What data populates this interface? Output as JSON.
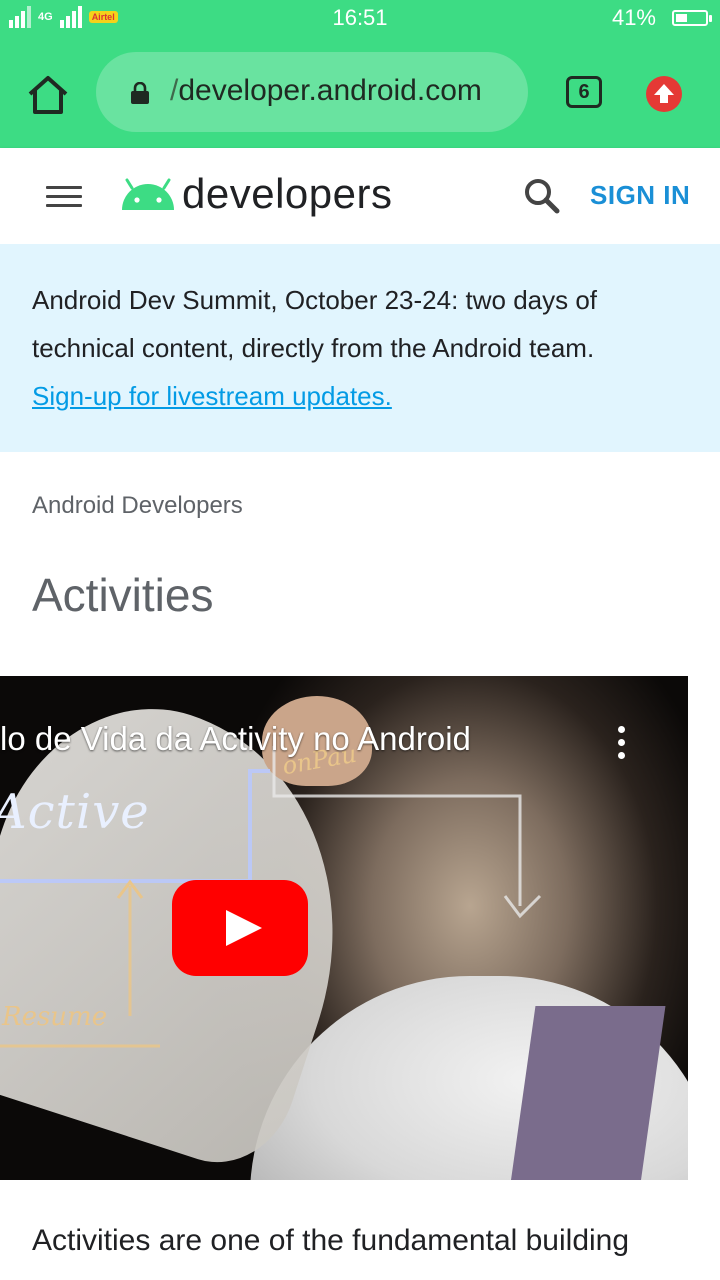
{
  "status_bar": {
    "network": "4G",
    "carrier_tag": "Airtel",
    "time": "16:51",
    "battery_percent": "41%",
    "battery_level": 0.41
  },
  "browser": {
    "url_prefix": "/",
    "url": "developer.android.com",
    "tab_count": "6",
    "colors": {
      "toolbar": "#3ddc84",
      "url_box": "#69e3a0",
      "update_badge": "#e53935"
    }
  },
  "site_header": {
    "brand": "developers",
    "sign_in": "SIGN IN",
    "icons": [
      "menu-icon",
      "android-logo-icon",
      "search-icon"
    ]
  },
  "banner": {
    "message": "Android Dev Summit, October 23-24: two days of technical content, directly from the Android team.",
    "link": "Sign-up for livestream updates."
  },
  "breadcrumb": "Android Developers",
  "page_title": "Activities",
  "video": {
    "title": "lo de Vida da Activity no Android",
    "board_words": {
      "active": "Active",
      "resume": "Resume",
      "on_pause": "onPau"
    }
  },
  "intro_text": "Activities are one of the fundamental building"
}
